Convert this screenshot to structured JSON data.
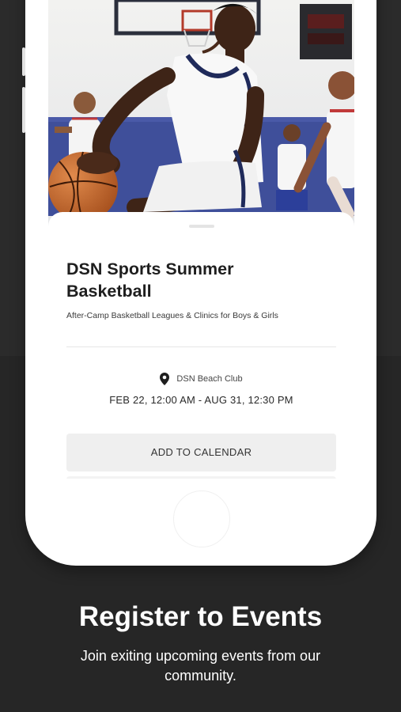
{
  "event": {
    "title": "DSN Sports Summer Basketball",
    "subtitle": "After-Camp Basketball Leagues & Clinics for Boys & Girls",
    "location": "DSN Beach Club",
    "dates": "FEB 22, 12:00 AM - AUG 31, 12:30 PM",
    "add_to_calendar_label": "ADD TO CALENDAR"
  },
  "promo": {
    "headline": "Register to Events",
    "tagline": "Join exiting upcoming events from our community."
  },
  "icons": {
    "location": "map-pin-icon"
  },
  "colors": {
    "background": "#2a2a2a",
    "phone_frame": "#ffffff",
    "button_bg": "#efefef"
  }
}
